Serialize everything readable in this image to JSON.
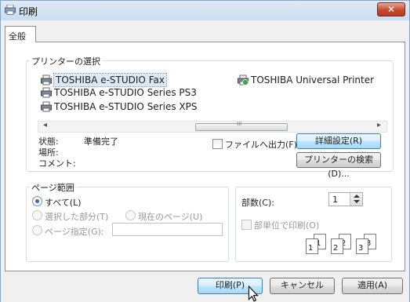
{
  "window": {
    "title": "印刷",
    "close_label": "✕"
  },
  "tabs": [
    {
      "label": "全般"
    }
  ],
  "printer_group": {
    "legend": "プリンターの選択",
    "printers": [
      {
        "name": "TOSHIBA e-STUDIO Fax",
        "selected": true
      },
      {
        "name": "TOSHIBA Universal Printer",
        "selected": false
      },
      {
        "name": "TOSHIBA e-STUDIO Series PS3",
        "selected": false
      },
      {
        "name": "TOSHIBA e-STUDIO Series XPS",
        "selected": false
      }
    ],
    "scroll_left": "◂",
    "scroll_right": "▸",
    "scroll_thumb_grip": "III"
  },
  "status": {
    "status_label": "状態:",
    "status_value": "準備完了",
    "location_label": "場所:",
    "comment_label": "コメント:",
    "print_to_file_label": "ファイルへ出力(F)",
    "preferences_button": "詳細設定(R)",
    "find_printer_button": "プリンターの検索(D)..."
  },
  "page_range": {
    "legend": "ページ範囲",
    "all_label": "すべて(L)",
    "selection_label": "選択した部分(T)",
    "current_page_label": "現在のページ(U)",
    "pages_label": "ページ指定(G):",
    "pages_value": ""
  },
  "copies": {
    "label": "部数(C):",
    "value": "1",
    "collate_label": "部単位で印刷(O)",
    "collate_pages": [
      "1",
      "1",
      "2",
      "2",
      "3",
      "3"
    ]
  },
  "footer": {
    "print_button": "印刷(P)",
    "cancel_button": "キャンセル",
    "apply_button": "適用(A)"
  },
  "colors": {
    "selection": "#dce8f6",
    "accent": "#3c7fb1",
    "close": "#c8482e"
  }
}
